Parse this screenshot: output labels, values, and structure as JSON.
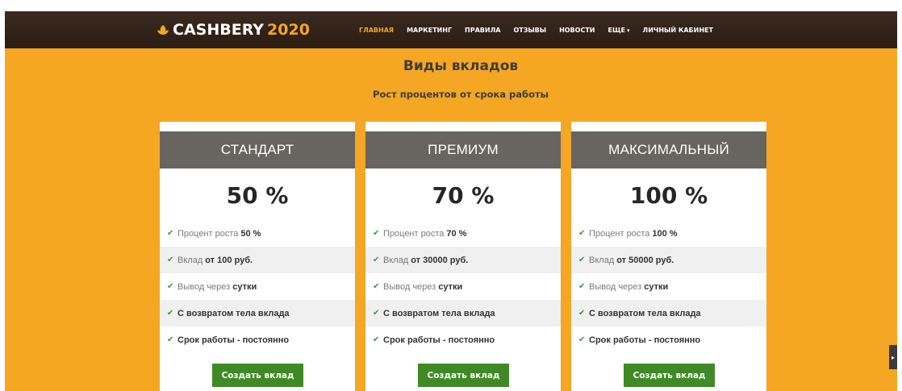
{
  "brand": {
    "name": "CASHBERY",
    "year": "2020",
    "icon": "leaf-logo-icon",
    "accent": "#f5a623"
  },
  "nav": {
    "items": [
      {
        "label": "ГЛАВНАЯ",
        "active": true
      },
      {
        "label": "МАРКЕТИНГ"
      },
      {
        "label": "ПРАВИЛА"
      },
      {
        "label": "ОТЗЫВЫ"
      },
      {
        "label": "НОВОСТИ"
      },
      {
        "label": "ЕЩЕ"
      },
      {
        "label": "ЛИЧНЫЙ КАБИНЕТ"
      }
    ],
    "more_icon": "chevron-down-icon"
  },
  "section": {
    "title": "Виды вкладов",
    "subtitle": "Рост процентов от срока работы"
  },
  "plans": [
    {
      "name": "СТАНДАРТ",
      "percent": "50 %",
      "features": [
        {
          "text": "Процент роста",
          "value": "50 %"
        },
        {
          "text": "Вклад",
          "value": "от 100 руб."
        },
        {
          "text": "Вывод через",
          "value": "сутки"
        },
        {
          "text": "С возвратом тела вклада"
        },
        {
          "text": "Срок работы - постоянно"
        }
      ],
      "button": "Создать вклад"
    },
    {
      "name": "ПРЕМИУМ",
      "percent": "70 %",
      "features": [
        {
          "text": "Процент роста",
          "value": "70 %"
        },
        {
          "text": "Вклад",
          "value": "от 30000 руб."
        },
        {
          "text": "Вывод через",
          "value": "сутки"
        },
        {
          "text": "С возвратом тела вклада"
        },
        {
          "text": "Срок работы - постоянно"
        }
      ],
      "button": "Создать вклад"
    },
    {
      "name": "МАКСИМАЛЬНЫЙ",
      "percent": "100 %",
      "features": [
        {
          "text": "Процент роста",
          "value": "100 %"
        },
        {
          "text": "Вклад",
          "value": "от 50000 руб."
        },
        {
          "text": "Вывод через",
          "value": "сутки"
        },
        {
          "text": "С возвратом тела вклада"
        },
        {
          "text": "Срок работы - постоянно"
        }
      ],
      "button": "Создать вклад"
    }
  ],
  "colors": {
    "page_bg": "#f5a623",
    "nav_bg": "#2b1d14",
    "card_header": "#686460",
    "button": "#3f8a26",
    "check": "#3a9a3a"
  },
  "icons": {
    "check": "check-icon",
    "scroll_tab": "scroll-tab-icon"
  }
}
